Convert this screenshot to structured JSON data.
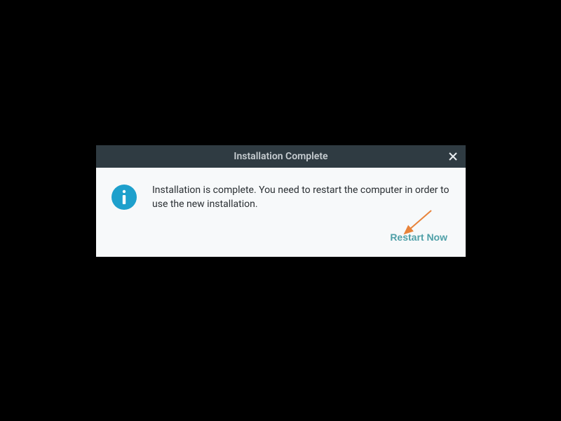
{
  "dialog": {
    "title": "Installation Complete",
    "message": "Installation is complete. You need to restart the computer in order to use the new installation.",
    "restart_label": "Restart Now"
  }
}
